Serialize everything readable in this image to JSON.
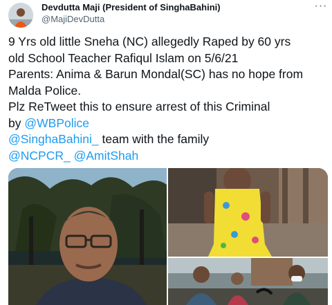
{
  "tweet": {
    "author_name": "Devdutta Maji (President of SinghaBahini)",
    "author_handle": "@MajiDevDutta",
    "more_icon": "more-icon",
    "lines": [
      {
        "parts": [
          {
            "text": "9 Yrs old little Sneha (NC) allegedly Raped by 60 yrs"
          }
        ]
      },
      {
        "parts": [
          {
            "text": "old School Teacher Rafiqul Islam on 5/6/21"
          }
        ]
      },
      {
        "parts": [
          {
            "text": "Parents: Anima & Barun Mondal(SC) has no hope from"
          }
        ]
      },
      {
        "parts": [
          {
            "text": "Malda Police."
          }
        ]
      },
      {
        "parts": [
          {
            "text": "Plz ReTweet this to ensure arrest of this Criminal"
          }
        ]
      },
      {
        "parts": [
          {
            "text": "by "
          },
          {
            "text": "@WBPolice",
            "link": true
          }
        ]
      },
      {
        "parts": [
          {
            "text": "@SinghaBahini_",
            "link": true
          },
          {
            "text": " team with the family"
          }
        ]
      },
      {
        "parts": [
          {
            "text": "@NCPCR_",
            "link": true
          },
          {
            "text": " "
          },
          {
            "text": "@AmitShah",
            "link": true
          }
        ]
      }
    ],
    "media": [
      {
        "name": "tweet-photo-man-portrait"
      },
      {
        "name": "tweet-photo-child-yellow-dress"
      },
      {
        "name": "tweet-photo-group-outdoors"
      }
    ],
    "colors": {
      "link": "#1d9bf0",
      "text": "#0f1419",
      "secondary": "#536471"
    }
  }
}
